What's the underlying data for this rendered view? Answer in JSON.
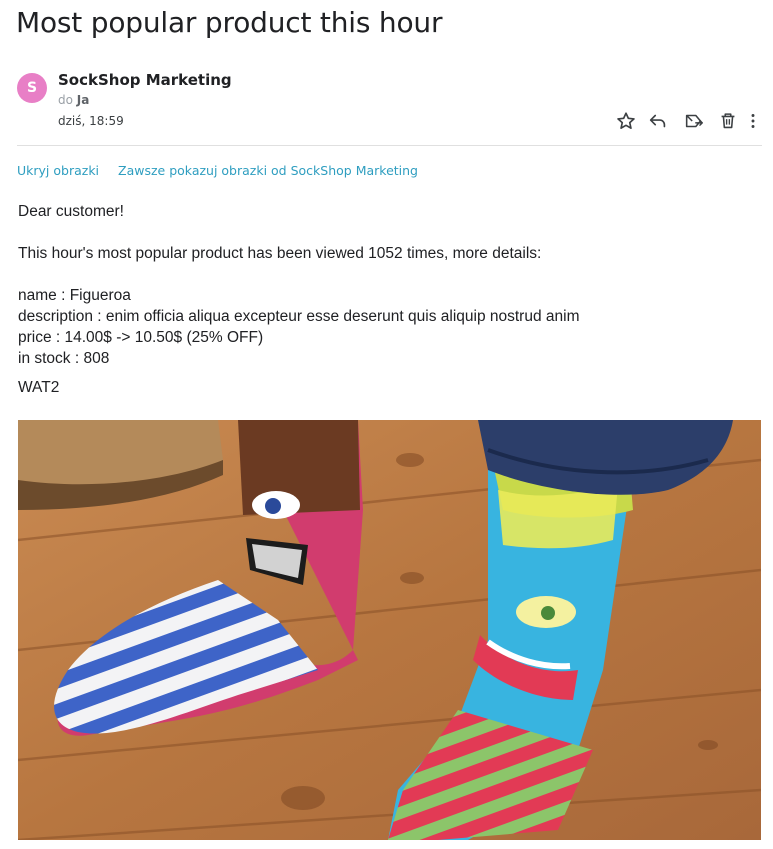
{
  "email": {
    "subject": "Most popular product this hour",
    "sender": {
      "name": "SockShop Marketing",
      "avatar_letter": "S",
      "avatar_color": "#e87fc6"
    },
    "recipient": {
      "prefix": "do",
      "name": "Ja"
    },
    "date": "dziś, 18:59",
    "actions": [
      {
        "name": "star-icon"
      },
      {
        "name": "reply-icon"
      },
      {
        "name": "forward-icon"
      },
      {
        "name": "delete-icon"
      },
      {
        "name": "more-icon"
      }
    ],
    "image_links": {
      "hide": "Ukryj obrazki",
      "always_show": "Zawsze pokazuj obrazki od SockShop Marketing"
    },
    "body": {
      "greeting": "Dear customer!",
      "intro": "This hour's most popular product has been viewed 1052 times, more details:",
      "name_line": "name : Figueroa",
      "description_line": "description : enim officia aliqua excepteur esse deserunt quis aliquip nostrud anim",
      "price_line": "price : 14.00$ -> 10.50$ (25% OFF)",
      "stock_line": "in stock : 808",
      "signature": "WAT2"
    },
    "link_color": "#2f9ec0"
  }
}
